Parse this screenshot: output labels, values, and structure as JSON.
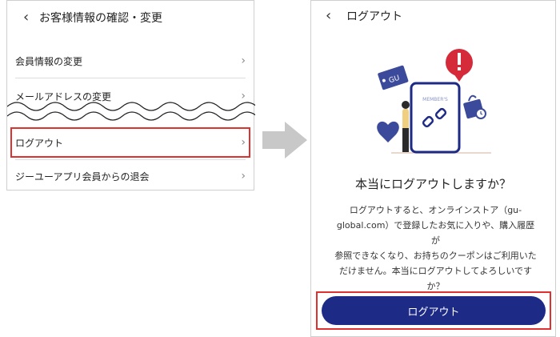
{
  "left": {
    "title": "お客様情報の確認・変更",
    "items": [
      {
        "label": "会員情報の変更"
      },
      {
        "label": "メールアドレスの変更"
      },
      {
        "label": "ログアウト"
      },
      {
        "label": "ジーユーアプリ会員からの退会"
      }
    ]
  },
  "right": {
    "title": "ログアウト",
    "illustration": {
      "tag": "GU",
      "phone_text": "MEMBER'S"
    },
    "question": "本当にログアウトしますか？",
    "message_lines": [
      "ログアウトすると、オンラインストア（gu-",
      "global.com）で登録したお気に入りや、購入履歴が",
      "参照できなくなり、お持ちのクーポンはご利用いた",
      "だけません。本当にログアウトしてよろしいです",
      "か？"
    ],
    "logout_button": "ログアウト"
  },
  "icons": {
    "back": "back-chevron-icon",
    "row": "chevron-right-icon"
  },
  "colors": {
    "highlight": "#e03131",
    "button": "#1d2a86",
    "alert": "#d42a3a",
    "arrow": "#c8c8c8"
  }
}
